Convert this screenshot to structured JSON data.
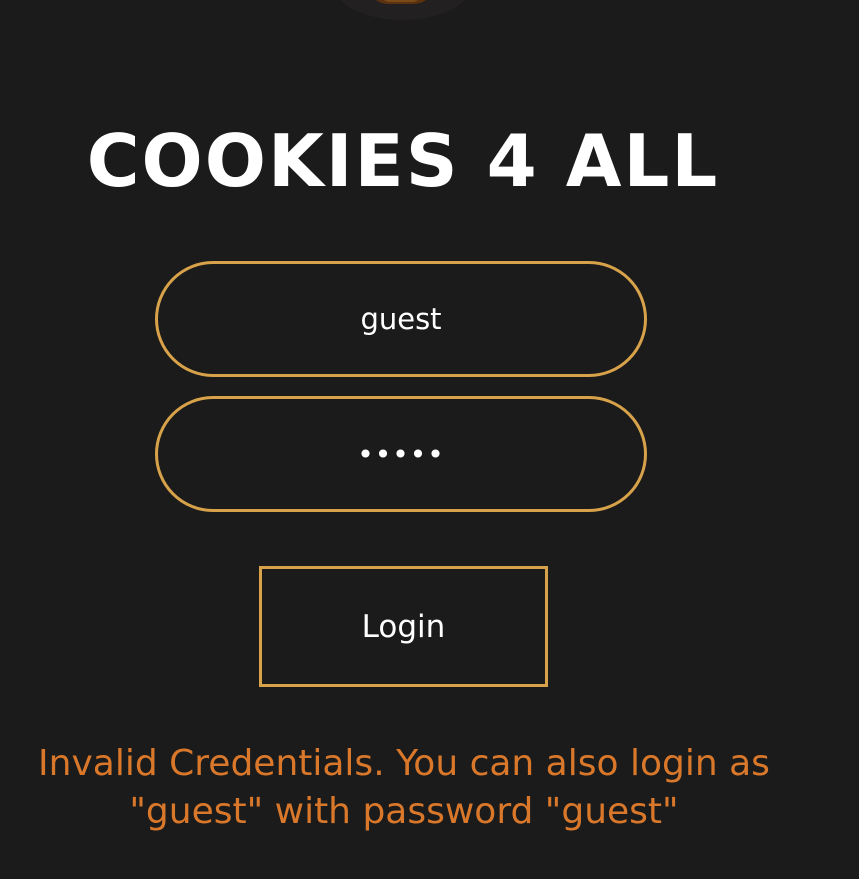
{
  "app": {
    "title": "COOKIES 4 ALL"
  },
  "logo": {
    "icon": "cookie-icon"
  },
  "login_form": {
    "username_value": "guest",
    "password_value": "•••••",
    "login_label": "Login"
  },
  "error": {
    "line1": "Invalid Credentials. You can also login as",
    "line2": "\"guest\" with password \"guest\""
  },
  "colors": {
    "background": "#1b1b1b",
    "accent": "#d7a24a",
    "error": "#d9782a",
    "text": "#ffffff"
  }
}
